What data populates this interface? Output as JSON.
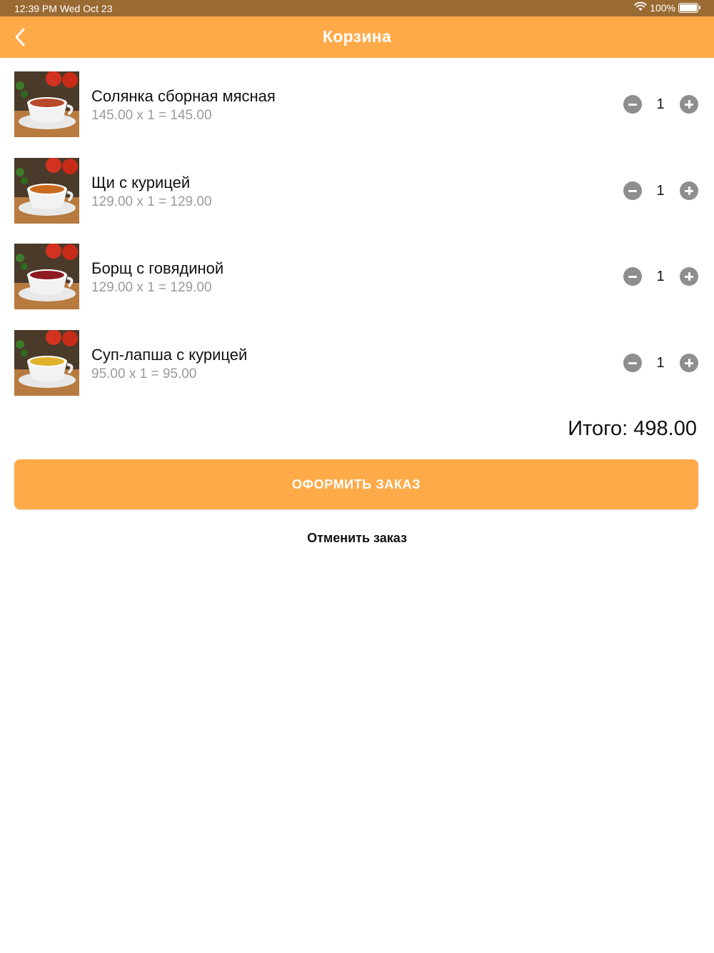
{
  "status_bar": {
    "time": "12:39 PM  Wed Oct 23",
    "battery_percent": "100%",
    "icons": [
      "wifi-icon",
      "battery-icon"
    ]
  },
  "header": {
    "title": "Корзина",
    "back_icon": "chevron-left-icon"
  },
  "items": [
    {
      "name": "Солянка сборная мясная",
      "calc": "145.00 x 1 = 145.00",
      "qty": "1",
      "soup_color": "#b74a2a"
    },
    {
      "name": "Щи с курицей",
      "calc": "129.00 x 1 = 129.00",
      "qty": "1",
      "soup_color": "#c96a1f"
    },
    {
      "name": "Борщ с говядиной",
      "calc": "129.00 x 1 = 129.00",
      "qty": "1",
      "soup_color": "#8e1a22"
    },
    {
      "name": "Суп-лапша с курицей",
      "calc": "95.00 x 1 = 95.00",
      "qty": "1",
      "soup_color": "#e0b22c"
    }
  ],
  "total": "Итого: 498.00",
  "checkout_label": "ОФОРМИТЬ ЗАКАЗ",
  "cancel_label": "Отменить заказ",
  "colors": {
    "accent": "#ffaa48",
    "status_bar": "#9a6a33",
    "stepper": "#8e8e8e",
    "secondary_text": "#9a9a9a"
  }
}
